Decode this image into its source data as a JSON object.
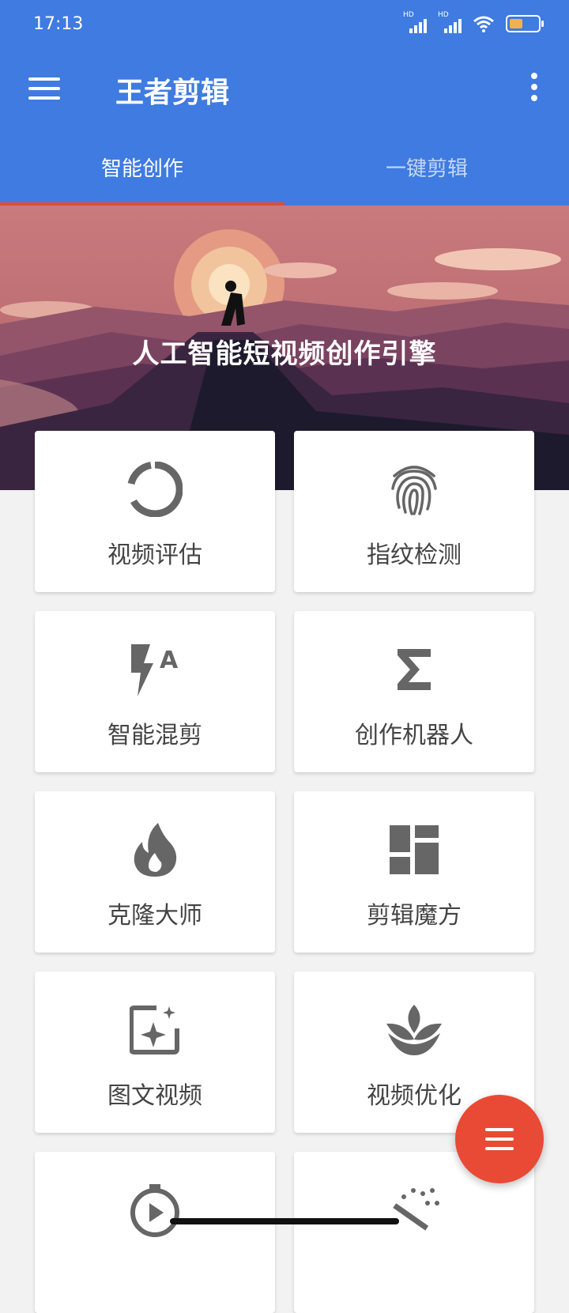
{
  "status": {
    "time": "17:13",
    "hd1": "HD",
    "hd2": "HD"
  },
  "appbar": {
    "title": "王者剪辑",
    "menu_icon": "hamburger-menu-icon",
    "more_icon": "more-vertical-icon"
  },
  "tabs": [
    {
      "label": "智能创作",
      "active": true
    },
    {
      "label": "一键剪辑",
      "active": false
    }
  ],
  "hero": {
    "text": "人工智能短视频创作引擎"
  },
  "features": [
    {
      "label": "视频评估",
      "icon": "donut-progress-icon"
    },
    {
      "label": "指纹检测",
      "icon": "fingerprint-icon"
    },
    {
      "label": "智能混剪",
      "icon": "flash-auto-icon"
    },
    {
      "label": "创作机器人",
      "icon": "sigma-icon"
    },
    {
      "label": "克隆大师",
      "icon": "flame-icon"
    },
    {
      "label": "剪辑魔方",
      "icon": "dashboard-blocks-icon"
    },
    {
      "label": "图文视频",
      "icon": "image-sparkle-icon"
    },
    {
      "label": "视频优化",
      "icon": "spa-leaf-icon"
    },
    {
      "label": "",
      "icon": "timer-play-icon"
    },
    {
      "label": "",
      "icon": "magic-wand-icon"
    }
  ],
  "fab": {
    "icon": "menu-icon"
  },
  "colors": {
    "primary": "#3f7be0",
    "accent": "#e84a35",
    "icon": "#666666"
  }
}
